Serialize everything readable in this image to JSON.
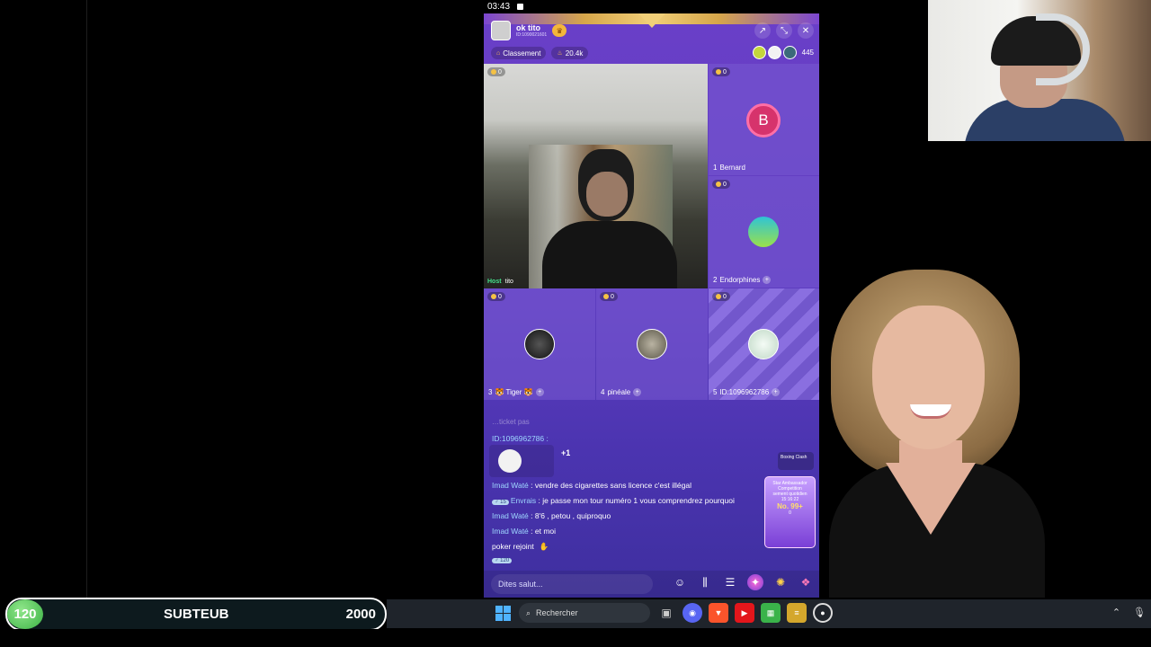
{
  "status_bar": {
    "time": "03:43"
  },
  "app": {
    "host_name": "ok tito",
    "host_id": "ID:1090021601",
    "ranking_label": "Classement",
    "heat": "20.4k",
    "viewer_count": "445"
  },
  "seats": [
    {
      "score": "0",
      "name": "tito",
      "host_label": "Host"
    },
    {
      "score": "0",
      "number": "1",
      "name": "Bernard",
      "initial": "B"
    },
    {
      "score": "0",
      "number": "2",
      "name": "Endorphines"
    },
    {
      "score": "0",
      "number": "3",
      "name": "🐯 Tiger 🐯"
    },
    {
      "score": "0",
      "number": "4",
      "name": "pinéale"
    },
    {
      "score": "0",
      "number": "5",
      "name": "ID:1096962786"
    }
  ],
  "chat": {
    "faded_line": "…ticket pas",
    "sticker_sender": "ID:1096962786 :",
    "sticker_count": "+1",
    "lines": [
      {
        "user": "Imad Waté",
        "text": " : vendre des cigarettes sans licence c'est illégal"
      },
      {
        "level": "♂ 15",
        "user": "Envrais",
        "text": " : je passe mon tour numéro 1 vous comprendrez pourquoi"
      },
      {
        "user": "Imad Waté",
        "text": " : 8'6 , petou , quiproquo"
      },
      {
        "user": "Imad Waté",
        "text": " : et moi"
      },
      {
        "user": "poker",
        "text": " rejoint"
      }
    ],
    "join_level": "♂ 120",
    "boxing_label": "Boxing Clash",
    "promo_title": "Star Ambassador Competition",
    "promo_sub": "sement quotidien",
    "promo_timer": "15:16:22",
    "promo_rank": "No. 99+",
    "promo_points": "0"
  },
  "input": {
    "placeholder": "Dites salut..."
  },
  "counter": {
    "current": "120",
    "label": "SUBTEUB",
    "goal": "2000"
  },
  "taskbar": {
    "search_label": "Rechercher"
  },
  "colors": {
    "app_purple": "#6a3fc8",
    "counter_green": "#3cb245",
    "taskbar_bg": "#1f242b"
  }
}
